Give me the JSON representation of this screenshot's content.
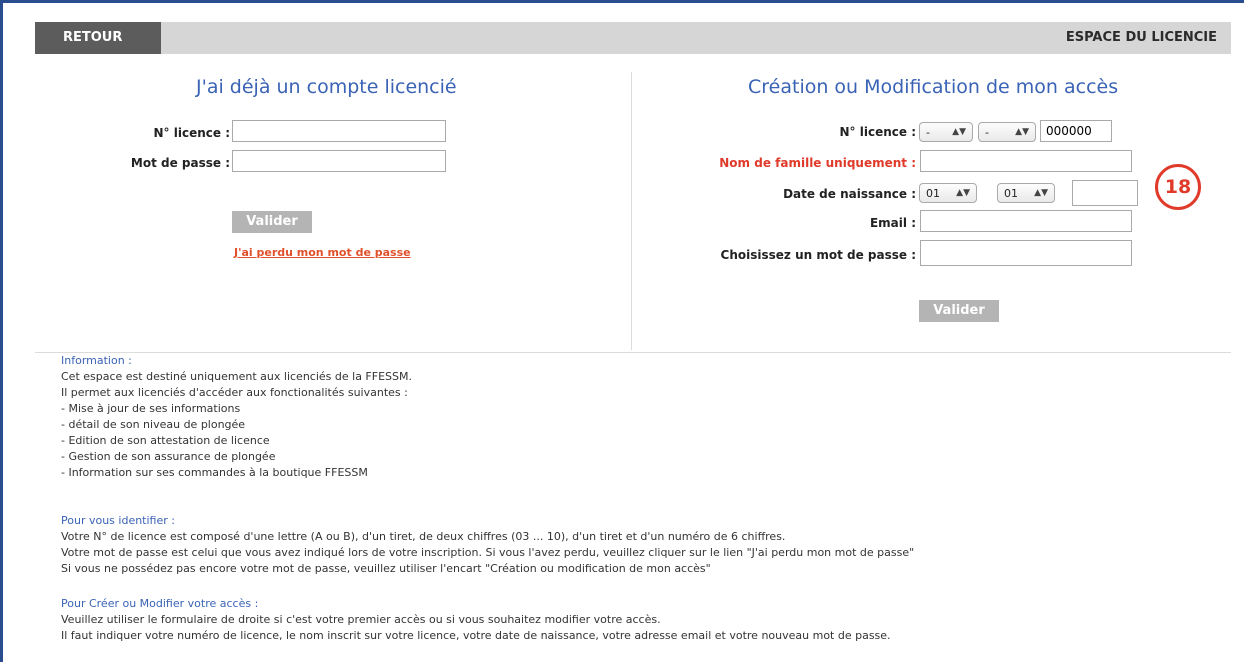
{
  "header": {
    "back_label": "RETOUR",
    "space_label": "ESPACE DU LICENCIE"
  },
  "login": {
    "title": "J'ai déjà un compte licencié",
    "licence_label": "N° licence :",
    "password_label": "Mot de passe :",
    "licence_value": "",
    "password_value": "",
    "submit_label": "Valider",
    "forgot_label": "J'ai perdu mon mot de passe"
  },
  "register": {
    "title": "Création ou Modification de mon accès",
    "licence_label": "N° licence :",
    "licence_letter": "-",
    "licence_digits": "-",
    "licence_number": "000000",
    "lastname_label": "Nom de famille uniquement :",
    "lastname_value": "",
    "birthdate_label": "Date de naissance :",
    "birth_day": "01",
    "birth_month": "01",
    "birth_year": "",
    "email_label": "Email :",
    "email_value": "",
    "newpass_label": "Choisissez un mot de passe :",
    "newpass_value": "",
    "submit_label": "Valider"
  },
  "badge": "18",
  "info": {
    "heading1": "Information :",
    "lines1": [
      "Cet espace est destiné uniquement aux licenciés de la FFESSM.",
      "Il permet aux licenciés d'accéder aux fonctionalités suivantes :",
      "- Mise à jour de ses informations",
      "- détail de son niveau de plongée",
      "- Edition de son attestation de licence",
      "- Gestion de son assurance de plongée",
      "- Information sur ses commandes à la boutique FFESSM"
    ],
    "heading2": "Pour vous identifier :",
    "lines2": [
      "Votre N° de licence est composé d'une lettre (A ou B), d'un tiret, de deux chiffres (03 ... 10), d'un tiret et d'un numéro de 6 chiffres.",
      "Votre mot de passe est celui que vous avez indiqué lors de votre inscription. Si vous l'avez perdu, veuillez cliquer sur le lien \"J'ai perdu mon mot de passe\"",
      "Si vous ne possédez pas encore votre mot de passe, veuillez utiliser l'encart \"Création ou modification de mon accès\""
    ],
    "heading3": "Pour Créer ou Modifier votre accès :",
    "lines3": [
      "Veuillez utiliser le formulaire de droite si c'est votre premier accès ou si vous souhaitez modifier votre accès.",
      "Il faut indiquer votre numéro de licence, le nom inscrit sur votre licence, votre date de naissance, votre adresse email et votre nouveau mot de passe."
    ]
  }
}
